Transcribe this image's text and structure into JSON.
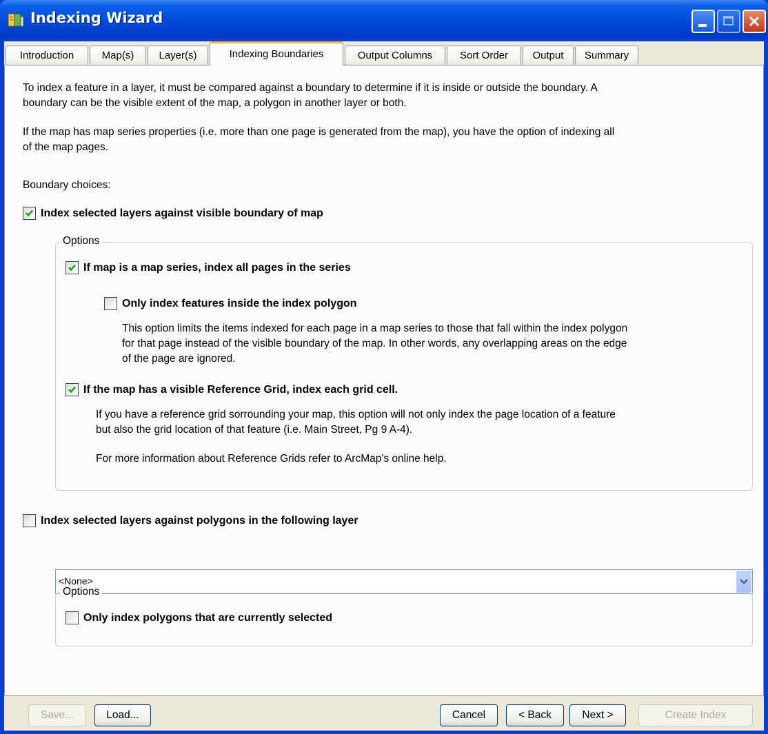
{
  "window": {
    "title": "Indexing Wizard"
  },
  "tabs": [
    {
      "label": "Introduction"
    },
    {
      "label": "Map(s)"
    },
    {
      "label": "Layer(s)"
    },
    {
      "label": "Indexing Boundaries"
    },
    {
      "label": "Output Columns"
    },
    {
      "label": "Sort Order"
    },
    {
      "label": "Output"
    },
    {
      "label": "Summary"
    }
  ],
  "active_tab": "Indexing Boundaries",
  "intro": {
    "para1_line1": "To index a feature in a layer, it must be compared against a boundary to determine if it is inside or outside the boundary.  A",
    "para1_line2": "boundary can be the visible extent of the map, a polygon in another layer or both.",
    "para2_line1": "If the map has map series properties (i.e. more than one page is generated from the map), you have the option of indexing all",
    "para2_line2": "of the map pages.",
    "boundary_choices": "Boundary choices:"
  },
  "visible_boundary": {
    "label": "Index selected layers against visible boundary of map",
    "checked": true,
    "options_legend": "Options",
    "map_series": {
      "label": "If map is a map series, index all pages in the series",
      "checked": true
    },
    "inside_polygon": {
      "label": "Only index features inside the index polygon",
      "checked": false,
      "desc_line1": "This option limits the items indexed for each page in a map series to those that fall within the index polygon",
      "desc_line2": "for that page instead of the visible boundary of the map.  In other words, any overlapping areas on the edge",
      "desc_line3": "of the page are ignored."
    },
    "reference_grid": {
      "label": "If the map has a visible Reference Grid, index each grid cell.",
      "checked": true,
      "desc_line1": "If you have a reference grid sorrounding your map, this option will not only index the page location of a feature",
      "desc_line2": "but also the grid location of that feature (i.e. Main Street, Pg 9 A-4).",
      "desc_line3": "For more information about Reference Grids refer to ArcMap's online help."
    }
  },
  "polygon_layer": {
    "label": "Index selected layers against polygons in the following layer",
    "checked": false,
    "dropdown_value": "<None>",
    "options_legend": "Options",
    "selected_only": {
      "label": "Only index polygons that are currently selected",
      "checked": false
    }
  },
  "buttons": {
    "save": "Save...",
    "load": "Load...",
    "cancel": "Cancel",
    "back": "< Back",
    "next": "Next >",
    "create_index": "Create Index"
  },
  "colors": {
    "title_bar": "#0048d8",
    "dialog_bg": "#ece9d8",
    "panel_bg": "#fcfcfe",
    "active_tab_accent": "#f7b23b",
    "check_green": "#21a121"
  }
}
